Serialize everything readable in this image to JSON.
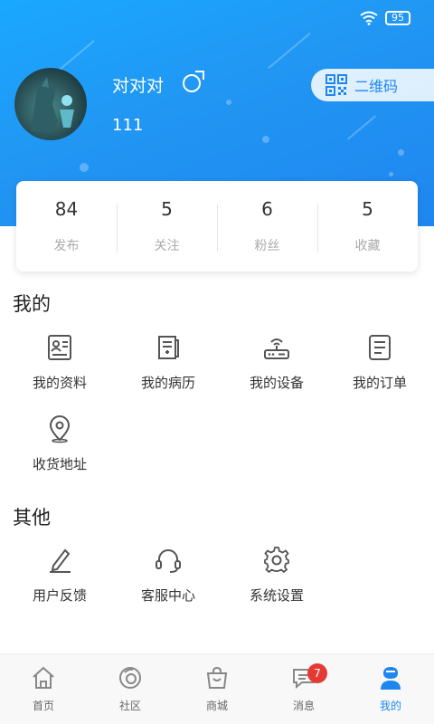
{
  "status": {
    "battery": "95"
  },
  "profile": {
    "username": "对对对",
    "user_id": "111"
  },
  "qr_button": {
    "label": "二维码"
  },
  "stats": [
    {
      "value": "84",
      "label": "发布"
    },
    {
      "value": "5",
      "label": "关注"
    },
    {
      "value": "6",
      "label": "粉丝"
    },
    {
      "value": "5",
      "label": "收藏"
    }
  ],
  "mine": {
    "title": "我的",
    "items": [
      {
        "label": "我的资料",
        "icon": "profile-card-icon"
      },
      {
        "label": "我的病历",
        "icon": "medical-record-icon"
      },
      {
        "label": "我的设备",
        "icon": "router-device-icon"
      },
      {
        "label": "我的订单",
        "icon": "order-list-icon"
      },
      {
        "label": "收货地址",
        "icon": "location-pin-icon"
      }
    ]
  },
  "other": {
    "title": "其他",
    "items": [
      {
        "label": "用户反馈",
        "icon": "pencil-icon"
      },
      {
        "label": "客服中心",
        "icon": "headset-icon"
      },
      {
        "label": "系统设置",
        "icon": "gear-icon"
      }
    ]
  },
  "tabs": [
    {
      "label": "首页",
      "icon": "home-icon"
    },
    {
      "label": "社区",
      "icon": "community-icon"
    },
    {
      "label": "商城",
      "icon": "shop-bag-icon"
    },
    {
      "label": "消息",
      "icon": "message-icon",
      "badge": "7"
    },
    {
      "label": "我的",
      "icon": "user-icon",
      "active": true
    }
  ],
  "colors": {
    "accent": "#1f86f0",
    "badge": "#e53935"
  }
}
